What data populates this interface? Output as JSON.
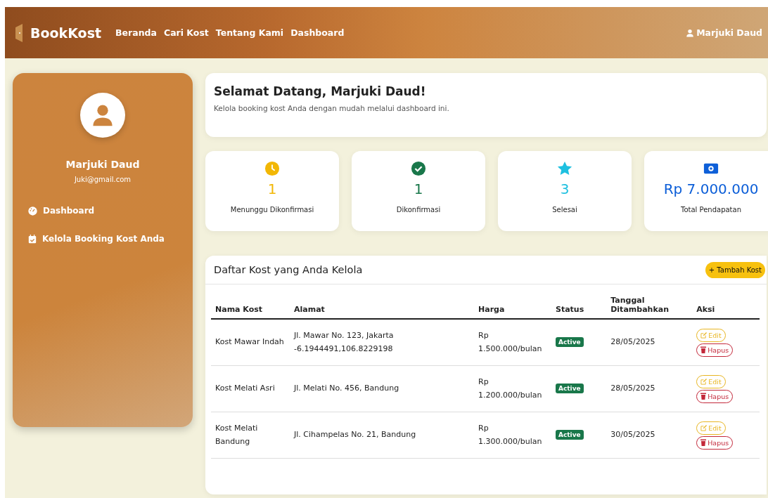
{
  "navbar": {
    "brand": "BookKost",
    "links": [
      {
        "label": "Beranda"
      },
      {
        "label": "Cari Kost"
      },
      {
        "label": "Tentang Kami"
      },
      {
        "label": "Dashboard"
      }
    ],
    "user": "Marjuki Daud"
  },
  "sidebar": {
    "name": "Marjuki Daud",
    "email": "Juki@gmail.com",
    "items": [
      {
        "label": "Dashboard",
        "kind": "dashboard"
      },
      {
        "label": "Kelola Booking Kost Anda",
        "kind": "calendar"
      }
    ]
  },
  "welcome": {
    "title": "Selamat Datang, Marjuki Daud!",
    "subtitle": "Kelola booking kost Anda dengan mudah melalui dashboard ini."
  },
  "stats": [
    {
      "kind": "clock",
      "value": "1",
      "label": "Menunggu Dikonfirmasi",
      "color": "#f2b705"
    },
    {
      "kind": "check",
      "value": "1",
      "label": "Dikonfirmasi",
      "color": "#19774a"
    },
    {
      "kind": "star",
      "value": "3",
      "label": "Selesai",
      "color": "#1ec0e0"
    },
    {
      "kind": "money",
      "value": "Rp 7.000.000",
      "label": "Total Pendapatan",
      "color": "#0d5fd8"
    }
  ],
  "table": {
    "title": "Daftar Kost yang Anda Kelola",
    "add_button": "+ Tambah Kost",
    "columns": [
      "Nama Kost",
      "Alamat",
      "Harga",
      "Status",
      "Tanggal Ditambahkan",
      "Aksi"
    ],
    "rows": [
      {
        "name": "Kost Mawar Indah",
        "address": [
          "Jl. Mawar No. 123, Jakarta",
          "-6.1944491,106.8229198"
        ],
        "price": "Rp 1.500.000/bulan",
        "status": "Active",
        "date": "28/05/2025",
        "edit": "Edit",
        "delete": "Hapus"
      },
      {
        "name": "Kost Melati Asri",
        "address": [
          "Jl. Melati No. 456, Bandung"
        ],
        "price": "Rp 1.200.000/bulan",
        "status": "Active",
        "date": "28/05/2025",
        "edit": "Edit",
        "delete": "Hapus"
      },
      {
        "name": "Kost Melati Bandung",
        "address": [
          "Jl. Cihampelas No. 21, Bandung"
        ],
        "price": "Rp 1.300.000/bulan",
        "status": "Active",
        "date": "30/05/2025",
        "edit": "Edit",
        "delete": "Hapus"
      }
    ]
  }
}
